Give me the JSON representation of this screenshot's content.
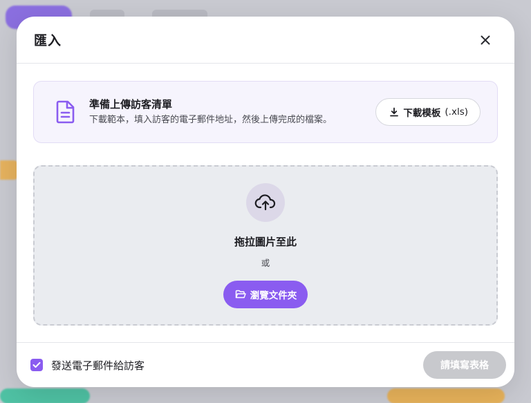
{
  "modal": {
    "title": "匯入",
    "close_icon": "close-icon"
  },
  "info_card": {
    "icon": "document-icon",
    "title": "準備上傳訪客清單",
    "description": "下載範本，填入訪客的電子郵件地址，然後上傳完成的檔案。",
    "download_label": "下載模板",
    "download_ext": "(.xls)",
    "download_icon": "download-icon"
  },
  "dropzone": {
    "icon": "cloud-upload-icon",
    "title": "拖拉圖片至此",
    "or_text": "或",
    "browse_label": "瀏覽文件夾",
    "browse_icon": "folder-icon"
  },
  "footer": {
    "checkbox_checked": true,
    "checkbox_label": "發送電子郵件給訪客",
    "submit_label": "請填寫表格"
  },
  "colors": {
    "accent": "#8a5cf0",
    "card_bg": "#f6f4fd",
    "dropzone_bg": "#eaecf0",
    "disabled_button": "#c8c9cd"
  }
}
